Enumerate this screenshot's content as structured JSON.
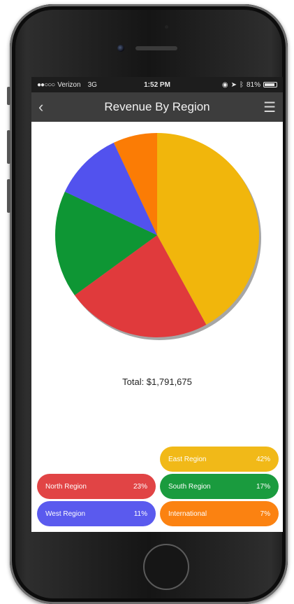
{
  "status_bar": {
    "carrier": "Verizon",
    "network": "3G",
    "time": "1:52 PM",
    "battery": "81%"
  },
  "nav": {
    "title": "Revenue By Region"
  },
  "summary": {
    "total_label": "Total: $1,791,675"
  },
  "chart_data": {
    "type": "pie",
    "title": "Revenue By Region",
    "slices": [
      {
        "name": "East Region",
        "value": 42,
        "color": "#f1b60c"
      },
      {
        "name": "North Region",
        "value": 23,
        "color": "#e03a3c"
      },
      {
        "name": "South Region",
        "value": 17,
        "color": "#0e9634"
      },
      {
        "name": "West Region",
        "value": 11,
        "color": "#5252ee"
      },
      {
        "name": "International",
        "value": 7,
        "color": "#fb7c05"
      }
    ]
  },
  "legend": [
    {
      "label": "East Region",
      "pct": "42%",
      "color": "#f1b60c"
    },
    {
      "label": "North Region",
      "pct": "23%",
      "color": "#e03a3c"
    },
    {
      "label": "South Region",
      "pct": "17%",
      "color": "#0e9634"
    },
    {
      "label": "West Region",
      "pct": "11%",
      "color": "#5252ee"
    },
    {
      "label": "International",
      "pct": "7%",
      "color": "#fb7c05"
    }
  ],
  "icons": {
    "back": "chevron-left-icon",
    "menu": "hamburger-menu-icon",
    "signal": "signal-dots-icon",
    "location": "location-arrow-icon",
    "bluetooth": "bluetooth-icon",
    "battery": "battery-icon"
  }
}
